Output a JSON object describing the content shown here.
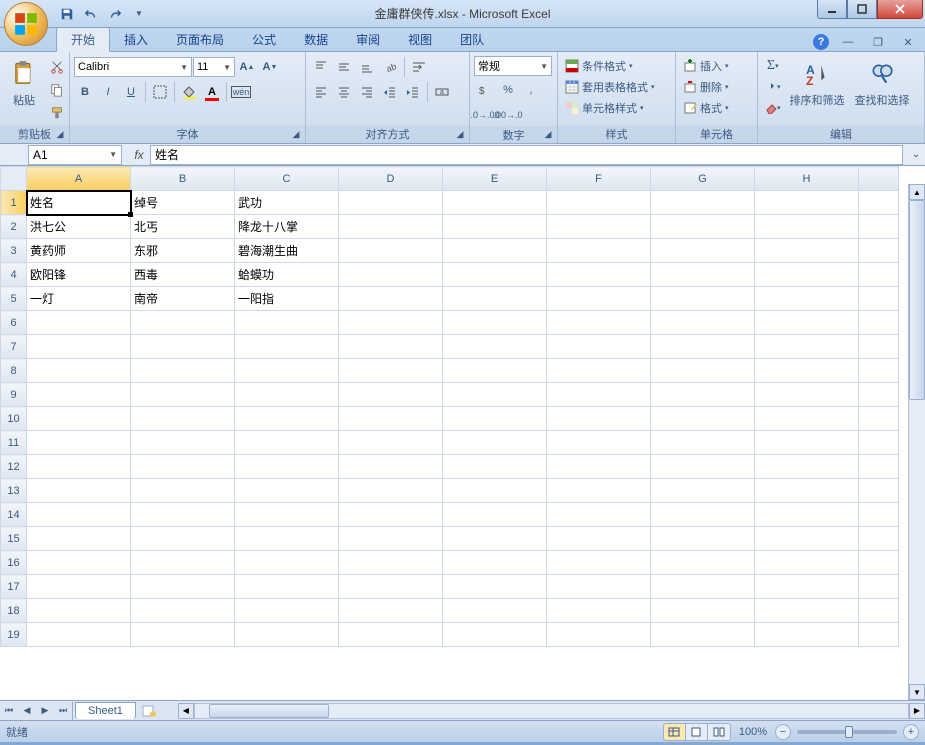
{
  "window": {
    "title": "金庸群侠传.xlsx - Microsoft Excel"
  },
  "tabs": {
    "home": "开始",
    "insert": "插入",
    "page_layout": "页面布局",
    "formulas": "公式",
    "data": "数据",
    "review": "审阅",
    "view": "视图",
    "team": "团队"
  },
  "ribbon": {
    "clipboard": {
      "label": "剪贴板",
      "paste": "粘贴"
    },
    "font": {
      "label": "字体",
      "name": "Calibri",
      "size": "11",
      "bold": "B",
      "italic": "I",
      "underline": "U"
    },
    "alignment": {
      "label": "对齐方式"
    },
    "number": {
      "label": "数字",
      "format": "常规"
    },
    "styles": {
      "label": "样式",
      "conditional": "条件格式",
      "table": "套用表格格式",
      "cell": "单元格样式"
    },
    "cells": {
      "label": "单元格",
      "insert": "插入",
      "delete": "删除",
      "format": "格式"
    },
    "editing": {
      "label": "编辑",
      "sort": "排序和筛选",
      "find": "查找和选择"
    }
  },
  "formula_bar": {
    "name_box": "A1",
    "fx": "fx",
    "value": "姓名"
  },
  "columns": [
    "A",
    "B",
    "C",
    "D",
    "E",
    "F",
    "G",
    "H"
  ],
  "rows": [
    1,
    2,
    3,
    4,
    5,
    6,
    7,
    8,
    9,
    10,
    11,
    12,
    13,
    14,
    15,
    16,
    17,
    18,
    19
  ],
  "active_cell": {
    "row": 1,
    "col": "A"
  },
  "cells": {
    "1": {
      "A": "姓名",
      "B": "绰号",
      "C": "武功"
    },
    "2": {
      "A": "洪七公",
      "B": "北丐",
      "C": "降龙十八掌"
    },
    "3": {
      "A": "黄药师",
      "B": "东邪",
      "C": "碧海潮生曲"
    },
    "4": {
      "A": "欧阳锋",
      "B": "西毒",
      "C": "蛤蟆功"
    },
    "5": {
      "A": "一灯",
      "B": "南帝",
      "C": "一阳指"
    }
  },
  "sheet_tabs": {
    "sheet1": "Sheet1"
  },
  "statusbar": {
    "ready": "就绪",
    "zoom": "100%"
  }
}
